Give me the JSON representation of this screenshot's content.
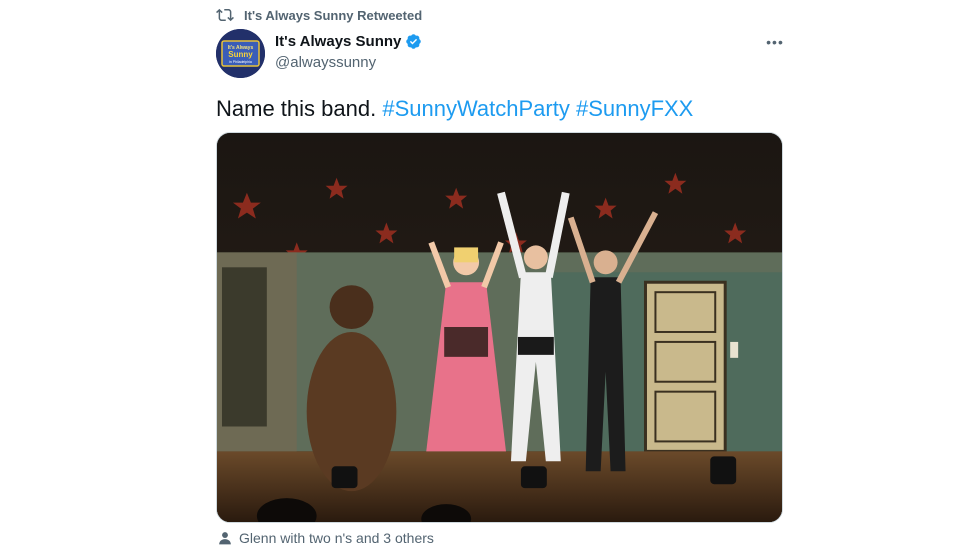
{
  "retweet": {
    "icon": "retweet-icon",
    "label": "It's Always Sunny Retweeted"
  },
  "author": {
    "avatar_text_line1": "It's Always",
    "avatar_text_line2": "Sunny",
    "avatar_text_line3": "in Philadelphia",
    "name": "It's Always Sunny",
    "verified_icon": "verified-badge-icon",
    "handle": "@alwayssunny"
  },
  "more_icon": "more-options-icon",
  "tweet": {
    "text": "Name this band.",
    "hashtags": [
      "#SunnyWatchParty",
      "#SunnyFXX"
    ]
  },
  "media": {
    "description_icon": "photo"
  },
  "tagged": {
    "icon": "person-icon",
    "label": "Glenn with two n's and 3 others"
  },
  "colors": {
    "accent": "#1d9bf0",
    "secondary_text": "#536471",
    "verified": "#1d9bf0"
  }
}
